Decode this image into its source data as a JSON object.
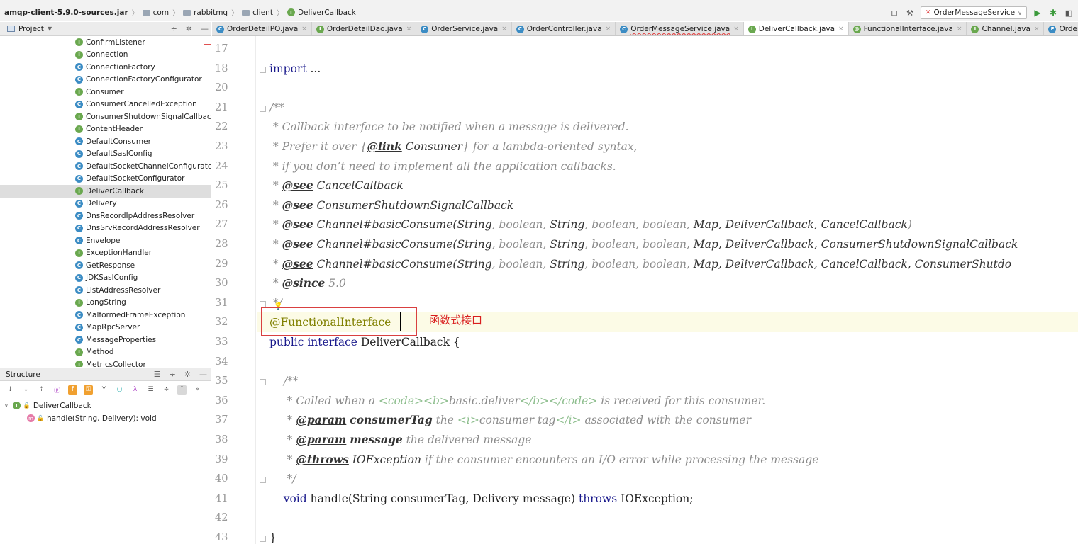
{
  "navbar": {
    "breadcrumbs": [
      "amqp-client-5.9.0-sources.jar",
      "com",
      "rabbitmq",
      "client",
      "DeliverCallback"
    ],
    "run_config": "OrderMessageService"
  },
  "project_panel": {
    "title": "Project"
  },
  "tabs": [
    {
      "label": "OrderDetailPO.java",
      "icon": "C"
    },
    {
      "label": "OrderDetailDao.java",
      "icon": "I"
    },
    {
      "label": "OrderService.java",
      "icon": "C"
    },
    {
      "label": "OrderController.java",
      "icon": "C"
    },
    {
      "label": "OrderMessageService.java",
      "icon": "C"
    },
    {
      "label": "DeliverCallback.java",
      "icon": "I"
    },
    {
      "label": "FunctionalInterface.java",
      "icon": "@"
    },
    {
      "label": "Channel.java",
      "icon": "I"
    },
    {
      "label": "OrderStatus.java",
      "icon": "E"
    }
  ],
  "tree": {
    "items": [
      {
        "label": "ConfirmListener",
        "icon": "I"
      },
      {
        "label": "Connection",
        "icon": "I"
      },
      {
        "label": "ConnectionFactory",
        "icon": "C"
      },
      {
        "label": "ConnectionFactoryConfigurator",
        "icon": "C"
      },
      {
        "label": "Consumer",
        "icon": "I"
      },
      {
        "label": "ConsumerCancelledException",
        "icon": "C"
      },
      {
        "label": "ConsumerShutdownSignalCallback",
        "icon": "I"
      },
      {
        "label": "ContentHeader",
        "icon": "I"
      },
      {
        "label": "DefaultConsumer",
        "icon": "C"
      },
      {
        "label": "DefaultSaslConfig",
        "icon": "C"
      },
      {
        "label": "DefaultSocketChannelConfigurator",
        "icon": "C"
      },
      {
        "label": "DefaultSocketConfigurator",
        "icon": "C"
      },
      {
        "label": "DeliverCallback",
        "icon": "I"
      },
      {
        "label": "Delivery",
        "icon": "C"
      },
      {
        "label": "DnsRecordIpAddressResolver",
        "icon": "C"
      },
      {
        "label": "DnsSrvRecordAddressResolver",
        "icon": "C"
      },
      {
        "label": "Envelope",
        "icon": "C"
      },
      {
        "label": "ExceptionHandler",
        "icon": "I"
      },
      {
        "label": "GetResponse",
        "icon": "C"
      },
      {
        "label": "JDKSaslConfig",
        "icon": "C"
      },
      {
        "label": "ListAddressResolver",
        "icon": "C"
      },
      {
        "label": "LongString",
        "icon": "I"
      },
      {
        "label": "MalformedFrameException",
        "icon": "C"
      },
      {
        "label": "MapRpcServer",
        "icon": "C"
      },
      {
        "label": "MessageProperties",
        "icon": "C"
      },
      {
        "label": "Method",
        "icon": "I"
      },
      {
        "label": "MetricsCollector",
        "icon": "I"
      }
    ]
  },
  "structure": {
    "title": "Structure",
    "root": "DeliverCallback",
    "method": "handle(String, Delivery): void"
  },
  "code": {
    "line_numbers": [
      "17",
      "18",
      "20",
      "21",
      "22",
      "23",
      "24",
      "25",
      "26",
      "27",
      "28",
      "29",
      "30",
      "31",
      "32",
      "33",
      "34",
      "35",
      "36",
      "37",
      "38",
      "39",
      "40",
      "41",
      "42",
      "43"
    ]
  },
  "annotation_note": "函数式接口"
}
